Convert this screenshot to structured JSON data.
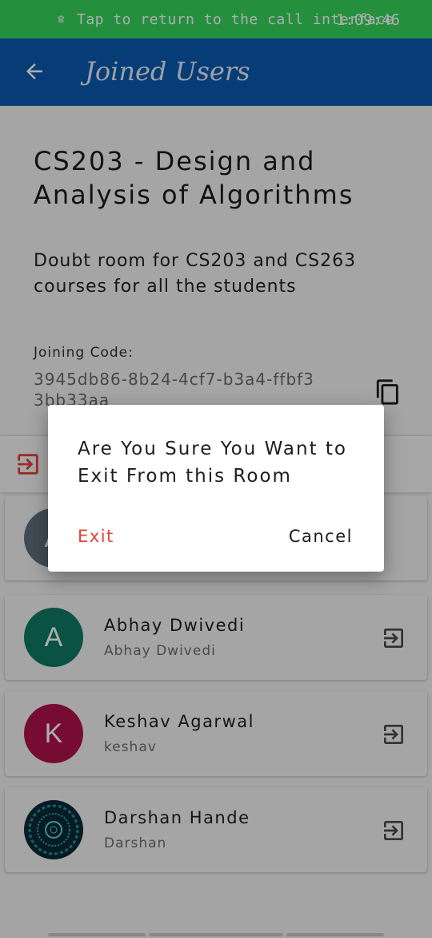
{
  "status_bar": {
    "message": "Tap to return to the call interface",
    "time": "1:09:46"
  },
  "app_bar": {
    "title": "Joined Users"
  },
  "room": {
    "title": "CS203 - Design and Analysis of Algorithms",
    "description": "Doubt room for CS203 and CS263 courses for all the students",
    "code_label": "Joining Code:",
    "code_value": "3945db86-8b24-4cf7-b3a4-ffbf33bb33aa"
  },
  "users": [
    {
      "initial": "A",
      "name": "",
      "subtitle": "",
      "color": "#5f6f7c"
    },
    {
      "initial": "A",
      "name": "Abhay Dwivedi",
      "subtitle": "Abhay Dwivedi",
      "color": "#0f7a64"
    },
    {
      "initial": "K",
      "name": "Keshav Agarwal",
      "subtitle": "keshav",
      "color": "#b0124a"
    },
    {
      "initial": "",
      "name": "Darshan Hande",
      "subtitle": "Darshan",
      "color": "#0b2a33"
    }
  ],
  "dialog": {
    "message": "Are You Sure You Want to Exit From this Room",
    "exit_label": "Exit",
    "cancel_label": "Cancel"
  },
  "colors": {
    "status_bar": "#35d55c",
    "app_bar": "#0a5ab0",
    "exit_accent": "#e0443a"
  }
}
